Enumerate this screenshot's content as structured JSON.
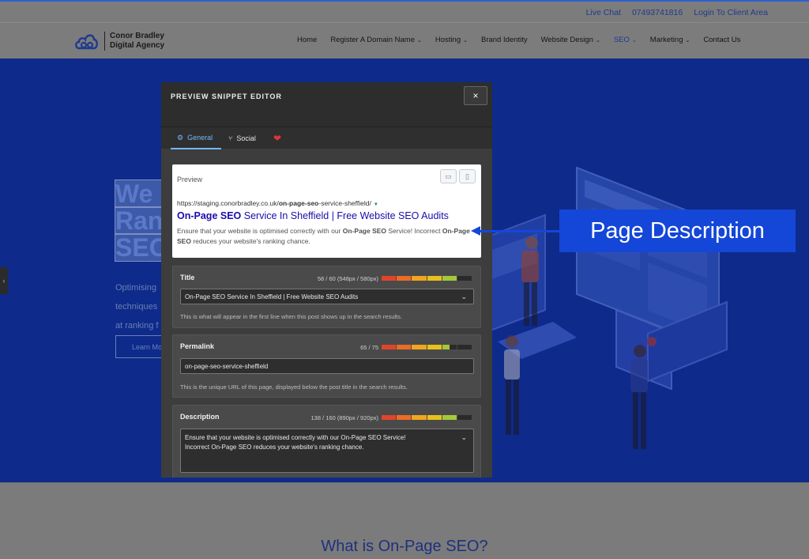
{
  "topbar": {
    "live_chat": "Live Chat",
    "phone": "07493741816",
    "login": "Login To Client Area"
  },
  "brand": {
    "line1": "Conor Bradley",
    "line2": "Digital Agency",
    "logo_color": "#1e3a8f"
  },
  "nav": {
    "items": [
      {
        "label": "Home",
        "dropdown": false
      },
      {
        "label": "Register A Domain Name",
        "dropdown": true
      },
      {
        "label": "Hosting",
        "dropdown": true
      },
      {
        "label": "Brand Identity",
        "dropdown": false
      },
      {
        "label": "Website Design",
        "dropdown": true
      },
      {
        "label": "SEO",
        "dropdown": true,
        "active": true
      },
      {
        "label": "Marketing",
        "dropdown": true
      },
      {
        "label": "Contact Us",
        "dropdown": false
      }
    ]
  },
  "hero": {
    "title_lines": [
      "We",
      "Ran",
      "SEO"
    ],
    "text_lines": [
      "Optimising",
      "techniques",
      "at ranking f"
    ],
    "button_label": "Learn Mo",
    "side_tab_label": "‹"
  },
  "lower": {
    "heading": "What is On-Page SEO?"
  },
  "callout": {
    "label": "Page Description",
    "color": "#1447d8"
  },
  "modal": {
    "title": "PREVIEW SNIPPET EDITOR",
    "close_label": "×",
    "tabs": {
      "general": "General",
      "social": "Social",
      "heart": "❤"
    },
    "preview": {
      "label": "Preview",
      "url_prefix": "https://staging.conorbradley.co.uk/",
      "url_bold": "on-page-seo",
      "url_suffix": "-service-sheffield/",
      "title_bold": "On-Page SEO",
      "title_rest": " Service In Sheffield | Free Website SEO Audits",
      "desc_part1": "Ensure that your website is optimised correctly with our ",
      "desc_bold1": "On-Page SEO",
      "desc_part2": " Service! Incorrect ",
      "desc_bold2": "On-Page SEO",
      "desc_part3": " reduces your website's ranking chance."
    },
    "title_field": {
      "label": "Title",
      "count": "58 / 60 (548px / 580px)",
      "value": "On-Page SEO Service In Sheffield | Free Website SEO Audits",
      "help": "This is what will appear in the first line when this post shows up in the search results.",
      "meter_filled": 5
    },
    "permalink_field": {
      "label": "Permalink",
      "count": "65 / 75",
      "value": "on-page-seo-service-sheffield",
      "help": "This is the unique URL of this page, displayed below the post title in the search results.",
      "meter_filled": 4.5
    },
    "description_field": {
      "label": "Description",
      "count": "138 / 160 (890px / 920px)",
      "value_line1": "Ensure that your website is optimised correctly with our On-Page SEO Service!",
      "value_line2": "Incorrect On-Page SEO reduces your website's ranking chance.",
      "meter_filled": 5
    },
    "meter_colors": [
      "#e0452b",
      "#ee6b26",
      "#f2a51f",
      "#e9c11c",
      "#a3c93a",
      "#6fbf3f"
    ]
  }
}
